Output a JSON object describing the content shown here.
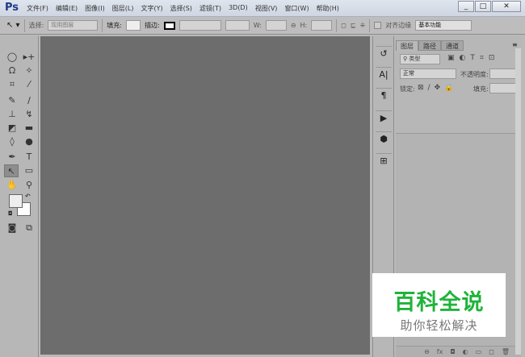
{
  "app": {
    "logo": "Ps"
  },
  "menu": [
    "文件(F)",
    "编辑(E)",
    "图像(I)",
    "图层(L)",
    "文字(Y)",
    "选择(S)",
    "滤镜(T)",
    "3D(D)",
    "视图(V)",
    "窗口(W)",
    "帮助(H)"
  ],
  "window_controls": {
    "minimize": "_",
    "maximize": "□",
    "close": "✕"
  },
  "options": {
    "select_label": "选择:",
    "select_value": "现用图层",
    "fill_label": "填充:",
    "stroke_label": "描边:",
    "w_label": "W:",
    "h_label": "H:",
    "align_edges": "对齐边缘",
    "workspace": "基本功能"
  },
  "layers_panel": {
    "tabs": [
      "图层",
      "路径",
      "通道"
    ],
    "filter_kind": "类型",
    "blend_mode": "正常",
    "opacity_label": "不透明度:",
    "lock_label": "锁定:",
    "fill_label": "填充:",
    "footer_icons": [
      "⊖",
      "fx",
      "◘",
      "◐",
      "▭",
      "◻",
      "🗑"
    ]
  },
  "watermark": {
    "title": "百科全说",
    "subtitle": "助你轻松解决"
  }
}
